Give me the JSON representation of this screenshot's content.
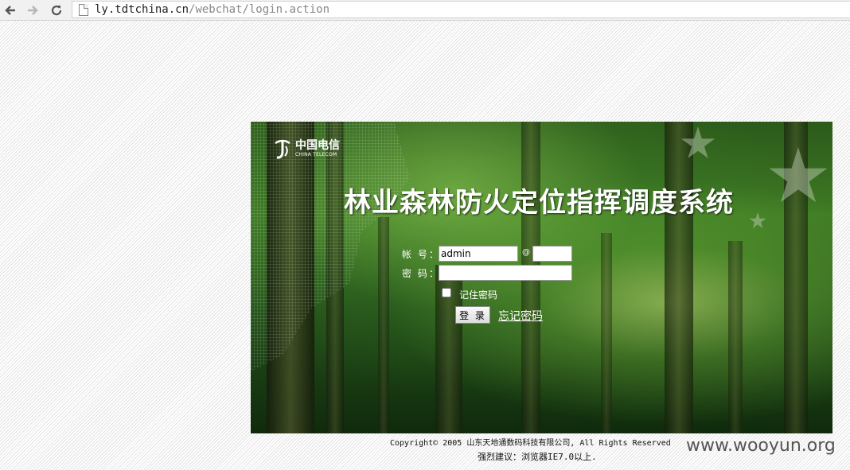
{
  "browser": {
    "icons": {
      "back": "back-arrow-icon",
      "forward": "forward-arrow-icon",
      "reload": "reload-icon",
      "page": "page-icon"
    },
    "url_host": "ly.tdtchina.cn",
    "url_path": "/webchat/login.action"
  },
  "banner": {
    "logo_cn": "中国电信",
    "logo_en": "CHINA TELECOM",
    "system_title": "林业森林防火定位指挥调度系统"
  },
  "login_form": {
    "account_label": "帐 号：",
    "account_value": "admin",
    "at_symbol": "@",
    "domain_value": "",
    "password_label": "密 码：",
    "password_value": "",
    "remember_label": "记住密码",
    "remember_checked": false,
    "login_button": "登 录",
    "forgot_password": "忘记密码"
  },
  "footer": {
    "copyright": "Copyright© 2005 山东天地通数码科技有限公司, All Rights Reserved",
    "browser_tip": "强烈建议：浏览器IE7.0以上."
  },
  "watermark": "www.wooyun.org",
  "colors": {
    "accent_green": "#2c5a1a",
    "text_white": "#ffffff"
  }
}
